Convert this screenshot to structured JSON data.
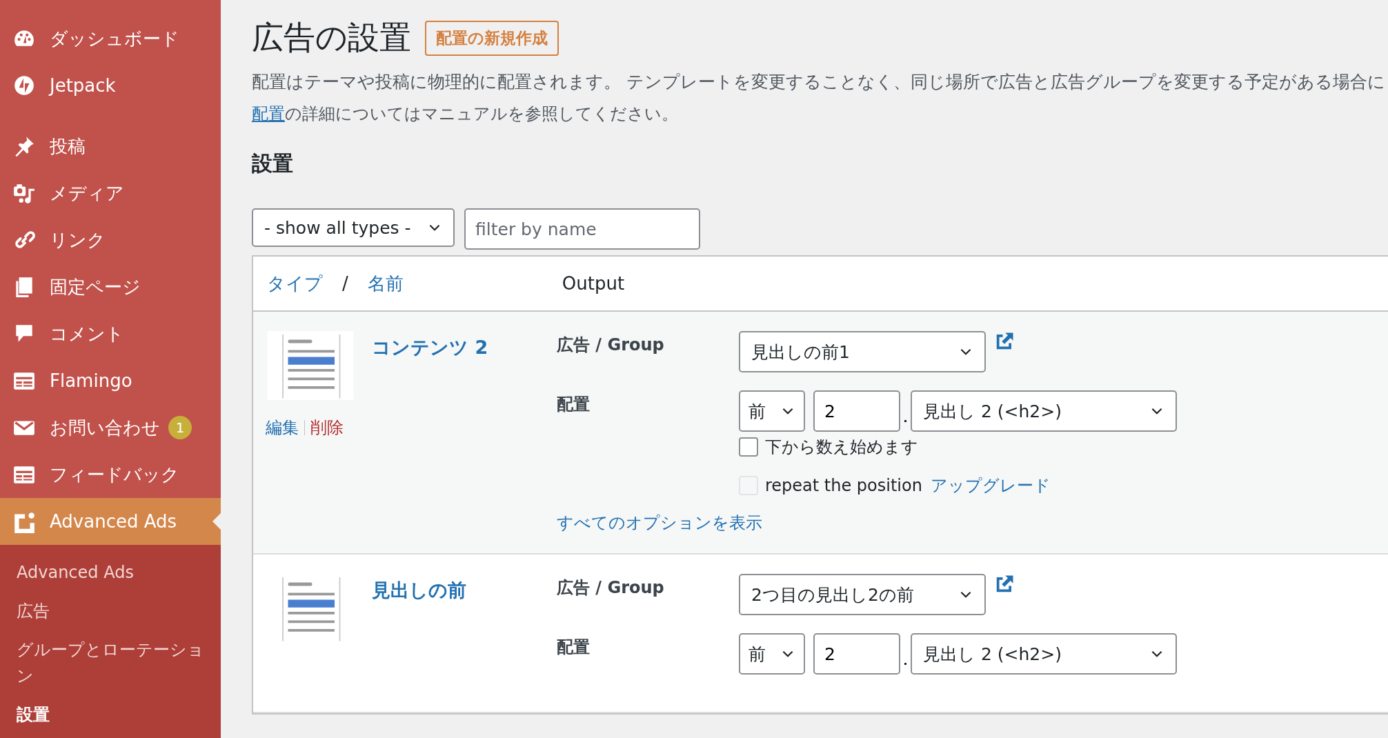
{
  "sidebar": {
    "menu": [
      {
        "label": "ダッシュボード",
        "selected": false
      },
      {
        "label": "Jetpack",
        "selected": false
      },
      {
        "label": "投稿",
        "selected": false
      },
      {
        "label": "メディア",
        "selected": false
      },
      {
        "label": "リンク",
        "selected": false
      },
      {
        "label": "固定ページ",
        "selected": false
      },
      {
        "label": "コメント",
        "selected": false
      },
      {
        "label": "Flamingo",
        "selected": false
      },
      {
        "label": "お問い合わせ",
        "badge": "1",
        "selected": false
      },
      {
        "label": "フィードバック",
        "selected": false
      },
      {
        "label": "Advanced Ads",
        "selected": true
      }
    ],
    "submenu": [
      {
        "label": "Advanced Ads",
        "selected": false
      },
      {
        "label": "広告",
        "selected": false
      },
      {
        "label": "グループとローテーション",
        "selected": false
      },
      {
        "label": "設置",
        "selected": true
      }
    ]
  },
  "page": {
    "title": "広告の設置",
    "add_button": "配置の新規作成",
    "description": "配置はテーマや投稿に物理的に配置されます。 テンプレートを変更することなく、同じ場所で広告と広告グループを変更する予定がある場合に",
    "manual_link": "配置",
    "manual_text": "の詳細についてはマニュアルを参照してください。",
    "section_title": "設置"
  },
  "filters": {
    "type_select": "- show all types -",
    "name_filter": {
      "placeholder": "filter by name"
    }
  },
  "table": {
    "header": {
      "type_link": "タイプ",
      "separator": "/",
      "name_link": "名前",
      "output": "Output"
    },
    "rows": [
      {
        "name": "コンテンツ 2",
        "actions": [
          {
            "label": "編集",
            "kind": "edit"
          },
          {
            "label": "削除",
            "kind": "delete"
          }
        ],
        "ad_label": "広告 / Group",
        "ad_value": "見出しの前1",
        "placement_label": "配置",
        "position": "前",
        "index": "2",
        "element": "見出し 2 (<h2>)",
        "count_from_bottom": {
          "label": "下から数え始めます",
          "checked": false
        },
        "repeat": {
          "label": "repeat the position",
          "disabled": true,
          "upgrade_link": "アップグレード"
        },
        "show_options": "すべてのオプションを表示"
      },
      {
        "name": "見出しの前",
        "ad_label": "広告 / Group",
        "ad_value": "2つ目の見出し2の前",
        "placement_label": "配置",
        "position": "前",
        "index": "2",
        "element": "見出し 2 (<h2>)"
      }
    ]
  }
}
